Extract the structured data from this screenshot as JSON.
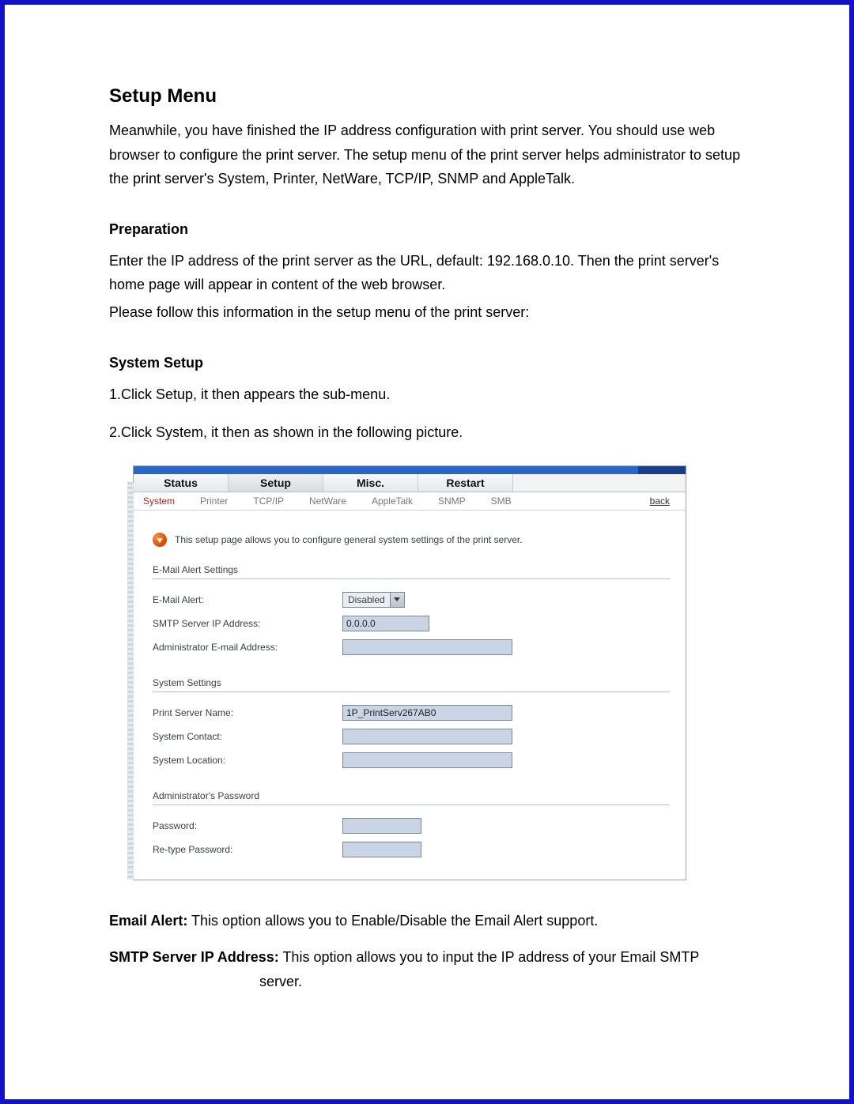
{
  "doc": {
    "title": "Setup Menu",
    "intro": "Meanwhile, you have finished the IP address configuration with print server. You should use web browser to configure the print server. The setup menu of the print server helps administrator to setup the print server's System, Printer, NetWare, TCP/IP, SNMP and AppleTalk.",
    "prep_heading": "Preparation",
    "prep_p1": "Enter the IP address of the print server as the URL, default: 192.168.0.10. Then the print server's home page will appear in content of the web browser.",
    "prep_p2": "Please follow this information in the setup menu of the print server:",
    "sys_heading": "System Setup",
    "sys_step1": "1.Click Setup, it then appears the sub-menu.",
    "sys_step2": "2.Click System, it then as shown in the following picture.",
    "email_alert_label": "Email Alert:",
    "email_alert_desc": " This option allows you to Enable/Disable the Email Alert support.",
    "smtp_label": "SMTP Server IP Address:",
    "smtp_desc": " This option allows you to input the IP address of your Email SMTP",
    "smtp_desc2": "server."
  },
  "shot": {
    "corner_text": "",
    "main_tabs": {
      "status": "Status",
      "setup": "Setup",
      "misc": "Misc.",
      "restart": "Restart"
    },
    "sub_tabs": {
      "system": "System",
      "printer": "Printer",
      "tcpip": "TCP/IP",
      "netware": "NetWare",
      "appletalk": "AppleTalk",
      "snmp": "SNMP",
      "smb": "SMB",
      "back": "back"
    },
    "info_text": "This setup page allows you to configure general system settings of the print server.",
    "sec_email": "E-Mail Alert Settings",
    "lbl_email_alert": "E-Mail Alert:",
    "val_email_alert": "Disabled",
    "lbl_smtp_ip": "SMTP Server IP Address:",
    "val_smtp_ip": "0.0.0.0",
    "lbl_admin_email": "Administrator E-mail Address:",
    "val_admin_email": "",
    "sec_system": "System Settings",
    "lbl_ps_name": "Print Server Name:",
    "val_ps_name": "1P_PrintServ267AB0",
    "lbl_contact": "System Contact:",
    "val_contact": "",
    "lbl_location": "System Location:",
    "val_location": "",
    "sec_pw": "Administrator's Password",
    "lbl_pw": "Password:",
    "val_pw": "",
    "lbl_pw2": "Re-type Password:",
    "val_pw2": ""
  }
}
